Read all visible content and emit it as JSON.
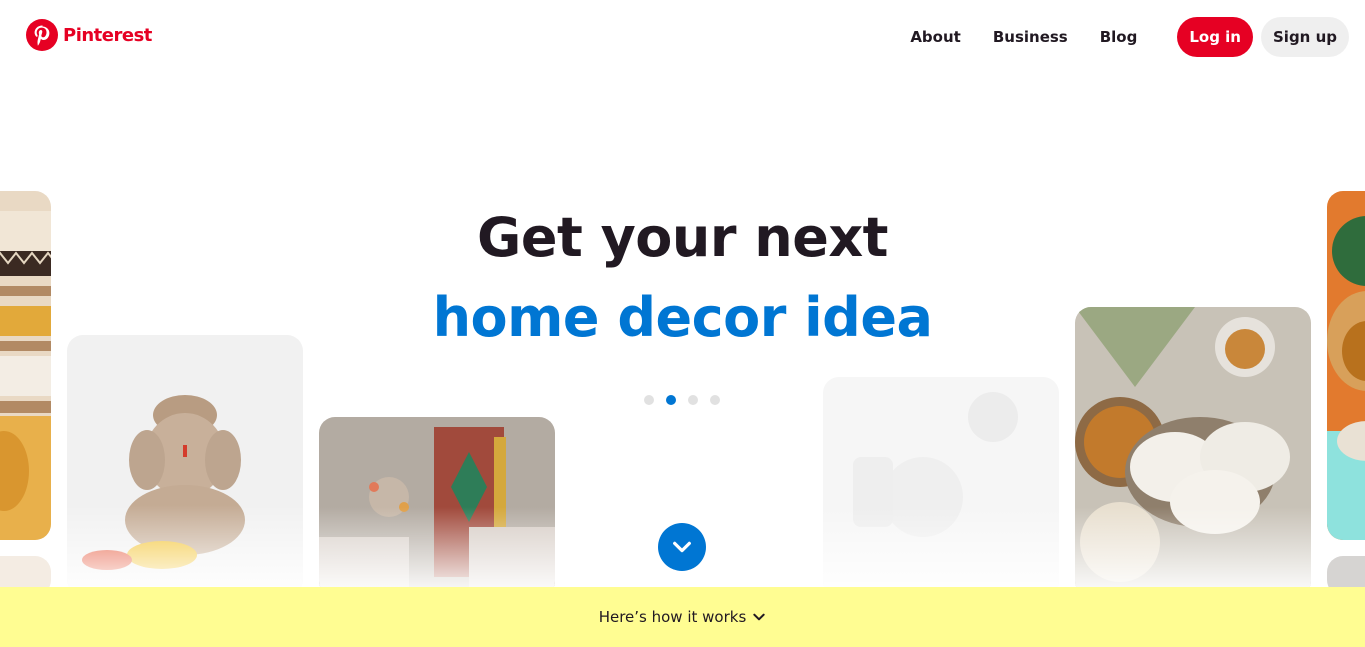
{
  "brand": {
    "name": "Pinterest",
    "color": "#e60023"
  },
  "nav": {
    "links": [
      "About",
      "Business",
      "Blog"
    ],
    "login_label": "Log in",
    "signup_label": "Sign up"
  },
  "hero": {
    "line1": "Get your next",
    "line2": "home decor idea",
    "accent_color": "#0076d3",
    "carousel_dots": 4,
    "active_dot": 2
  },
  "pins": [
    {
      "subject": "folded textiles on shelves"
    },
    {
      "subject": "ganesha statue"
    },
    {
      "subject": "traditional doorway with flowers"
    },
    {
      "subject": "white tableware"
    },
    {
      "subject": "idli with chutney and sambar"
    },
    {
      "subject": "food platter"
    }
  ],
  "banner": {
    "label": "Here’s how it works",
    "color": "#fffd92"
  },
  "icons": {
    "logo": "pinterest-logo-icon",
    "scroll": "chevron-down-icon",
    "banner": "chevron-down-icon"
  }
}
